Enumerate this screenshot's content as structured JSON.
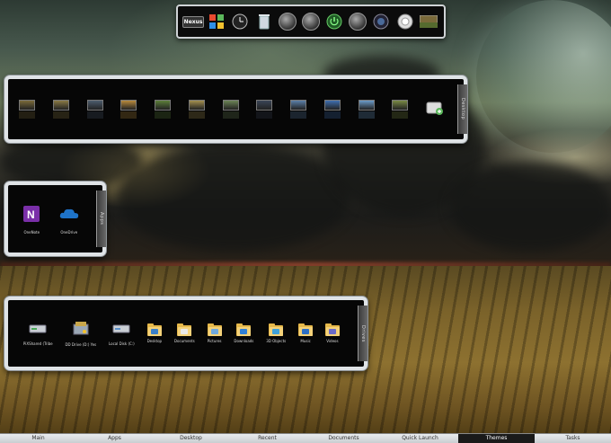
{
  "top_dock": {
    "icons": [
      "nexus-logo-icon",
      "windows-logo-icon",
      "clock-icon",
      "recycle-bin-icon",
      "control-icon",
      "eject-icon",
      "power-icon",
      "settings-icon",
      "camera-icon",
      "media-icon",
      "picture-icon"
    ],
    "nexus_label": "Nexus"
  },
  "desktop_panel": {
    "tab_label": "Desktop",
    "thumbnails": [
      {
        "name": "wallpaper-1",
        "color": "#7b6b3a"
      },
      {
        "name": "wallpaper-2",
        "color": "#8a7a45"
      },
      {
        "name": "wallpaper-3",
        "color": "#4d5d6e"
      },
      {
        "name": "wallpaper-4",
        "color": "#b88a3c"
      },
      {
        "name": "wallpaper-5",
        "color": "#5d7f3a"
      },
      {
        "name": "wallpaper-6",
        "color": "#a38f4f"
      },
      {
        "name": "wallpaper-7",
        "color": "#6c8456"
      },
      {
        "name": "wallpaper-8",
        "color": "#3a4557"
      },
      {
        "name": "wallpaper-9",
        "color": "#5b7fa8"
      },
      {
        "name": "wallpaper-10",
        "color": "#3f6fb0"
      },
      {
        "name": "wallpaper-11",
        "color": "#6b9bc8"
      },
      {
        "name": "wallpaper-12",
        "color": "#7a8a45"
      }
    ],
    "add_icon": "add-desktop-icon"
  },
  "apps_panel": {
    "tab_label": "Apps",
    "items": [
      {
        "label": "OneNote",
        "icon": "onenote-icon",
        "color": "#7a2fa8"
      },
      {
        "label": "OneDrive",
        "icon": "onedrive-icon",
        "color": "#1e73c9"
      }
    ]
  },
  "drives_panel": {
    "tab_label": "Drives",
    "items": [
      {
        "label": "PiXShared (Tribe",
        "icon": "network-drive-icon",
        "kind": "drive",
        "color": "#4aa85a"
      },
      {
        "label": "DD Drive (D:) Yes",
        "icon": "dvd-drive-icon",
        "kind": "dvd",
        "color": "#c9a64a"
      },
      {
        "label": "Local Disk (C:)",
        "icon": "local-disk-icon",
        "kind": "drive",
        "color": "#5a8fc8"
      },
      {
        "label": "Desktop",
        "icon": "desktop-folder-icon",
        "kind": "folder",
        "color": "#3a7fc8"
      },
      {
        "label": "Documents",
        "icon": "documents-folder-icon",
        "kind": "folder",
        "color": "#e8e8e8"
      },
      {
        "label": "Pictures",
        "icon": "pictures-folder-icon",
        "kind": "folder",
        "color": "#6fa8dc"
      },
      {
        "label": "Downloads",
        "icon": "downloads-folder-icon",
        "kind": "folder",
        "color": "#2f7fd6"
      },
      {
        "label": "3D Objects",
        "icon": "3d-objects-folder-icon",
        "kind": "folder",
        "color": "#3fa0d8"
      },
      {
        "label": "Music",
        "icon": "music-folder-icon",
        "kind": "folder",
        "color": "#2d6fc4"
      },
      {
        "label": "Videos",
        "icon": "videos-folder-icon",
        "kind": "folder",
        "color": "#6a6ac8"
      }
    ]
  },
  "bottom_bar": {
    "tabs": [
      {
        "label": "Main",
        "active": false
      },
      {
        "label": "Apps",
        "active": false
      },
      {
        "label": "Desktop",
        "active": false
      },
      {
        "label": "Recent",
        "active": false
      },
      {
        "label": "Documents",
        "active": false
      },
      {
        "label": "Quick Launch",
        "active": false
      },
      {
        "label": "Themes",
        "active": true
      },
      {
        "label": "Tasks",
        "active": false
      }
    ]
  }
}
